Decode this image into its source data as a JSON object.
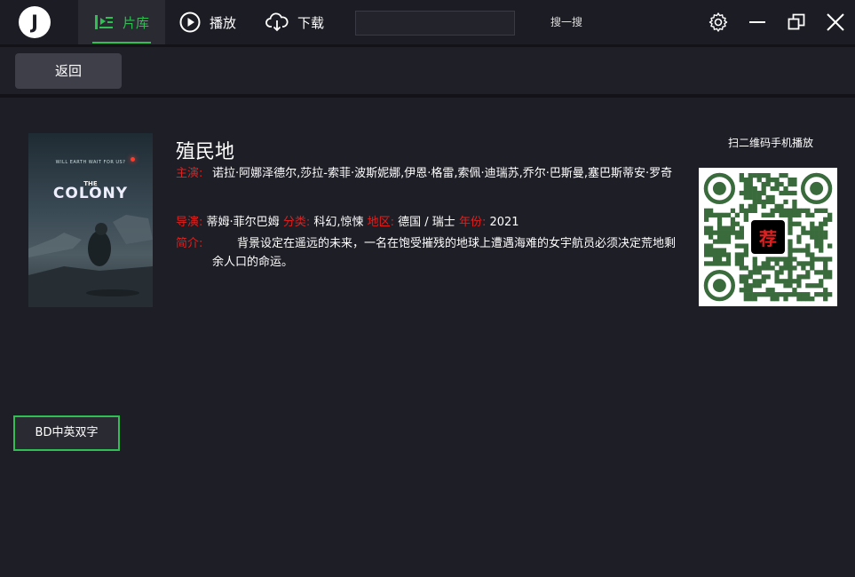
{
  "app": {
    "logo_text": "J"
  },
  "nav": {
    "tabs": [
      {
        "label": "片库",
        "icon": "library-icon",
        "active": true
      },
      {
        "label": "播放",
        "icon": "play-circle-icon",
        "active": false
      },
      {
        "label": "下载",
        "icon": "cloud-download-icon",
        "active": false
      }
    ]
  },
  "search": {
    "value": "",
    "placeholder": "",
    "button_label": "搜一搜"
  },
  "window": {
    "settings_icon": "gear-icon",
    "minimize_icon": "minimize-icon",
    "restore_icon": "restore-icon",
    "close_icon": "close-icon"
  },
  "toolbar": {
    "back_label": "返回"
  },
  "movie": {
    "title": "殖民地",
    "poster_small_text": "WILL EARTH WAIT FOR US?",
    "poster_title_the": "THE",
    "poster_title_main": "COLONY",
    "cast_label": "主演:",
    "cast_value": "诺拉·阿娜泽德尔,莎拉-索菲·波斯妮娜,伊恩·格雷,索佩·迪瑞苏,乔尔·巴斯曼,塞巴斯蒂安·罗奇",
    "director_label": "导演:",
    "director_value": "蒂姆·菲尔巴姆",
    "genre_label": "分类:",
    "genre_value": "科幻,惊悚",
    "region_label": "地区:",
    "region_value": "德国 / 瑞士",
    "year_label": "年份:",
    "year_value": "2021",
    "synopsis_label": "简介:",
    "synopsis_value": "背景设定在遥远的未来，一名在饱受摧残的地球上遭遇海难的女宇航员必须决定荒地剩余人口的命运。"
  },
  "qr": {
    "label": "扫二维码手机播放",
    "center_text": "荐"
  },
  "quality": {
    "label": "BD中英双字"
  },
  "colors": {
    "accent": "#2fbf52",
    "label_red": "#e0201e",
    "background": "#1e1e26",
    "qr_green": "#3a6b3c"
  }
}
